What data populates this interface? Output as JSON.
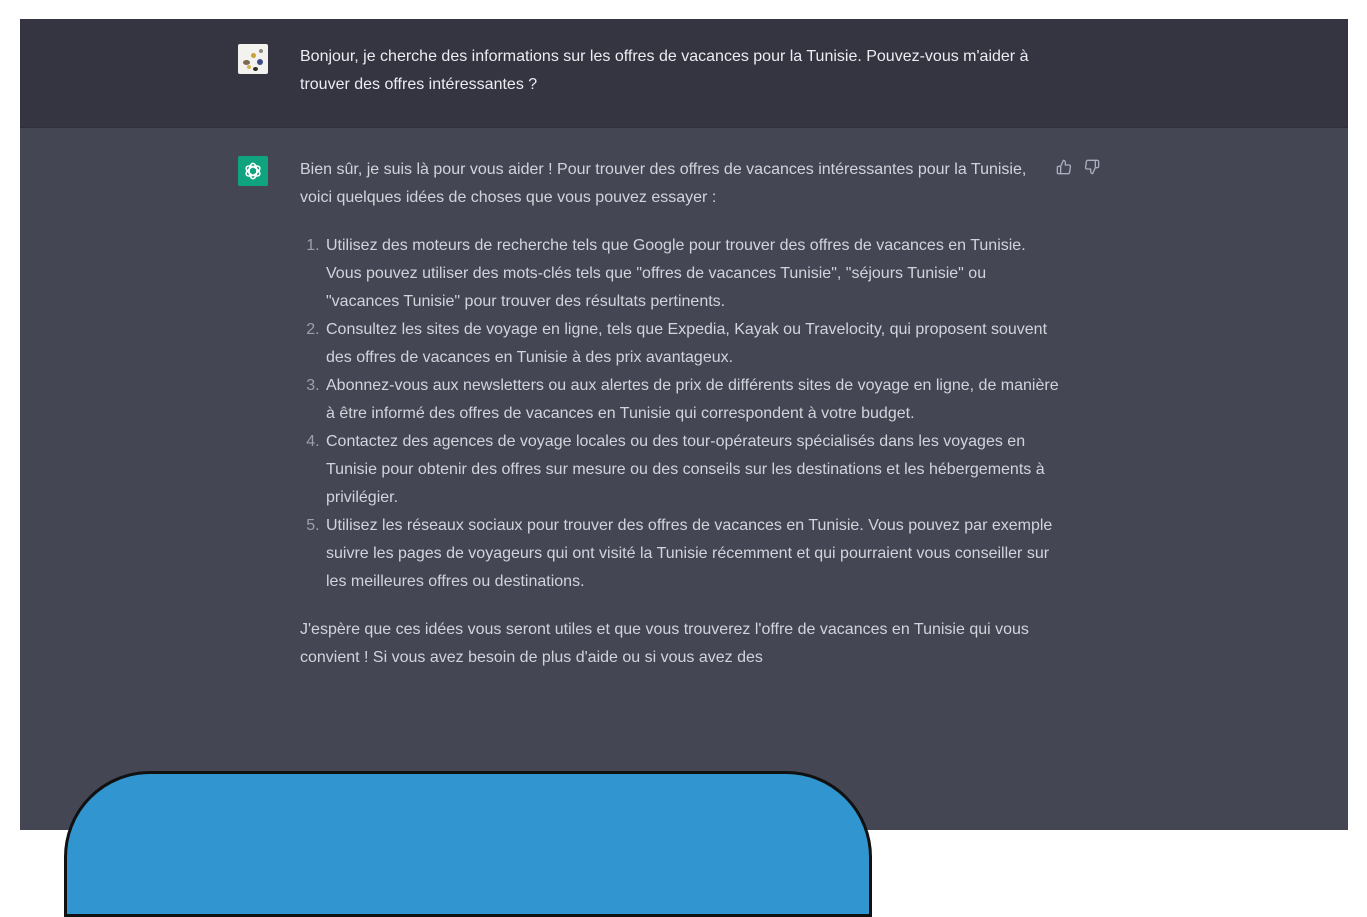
{
  "conversation": {
    "user_message": {
      "text": "Bonjour, je cherche des informations sur les offres de vacances pour la Tunisie. Pouvez-vous m'aider à trouver des offres intéressantes ?"
    },
    "assistant_message": {
      "intro": "Bien sûr, je suis là pour vous aider ! Pour trouver des offres de vacances intéressantes pour la Tunisie, voici quelques idées de choses que vous pouvez essayer :",
      "list": [
        "Utilisez des moteurs de recherche tels que Google pour trouver des offres de vacances en Tunisie. Vous pouvez utiliser des mots-clés tels que \"offres de vacances Tunisie\", \"séjours Tunisie\" ou \"vacances Tunisie\" pour trouver des résultats pertinents.",
        "Consultez les sites de voyage en ligne, tels que Expedia, Kayak ou Travelocity, qui proposent souvent des offres de vacances en Tunisie à des prix avantageux.",
        "Abonnez-vous aux newsletters ou aux alertes de prix de différents sites de voyage en ligne, de manière à être informé des offres de vacances en Tunisie qui correspondent à votre budget.",
        "Contactez des agences de voyage locales ou des tour-opérateurs spécialisés dans les voyages en Tunisie pour obtenir des offres sur mesure ou des conseils sur les destinations et les hébergements à privilégier.",
        "Utilisez les réseaux sociaux pour trouver des offres de vacances en Tunisie. Vous pouvez par exemple suivre les pages de voyageurs qui ont visité la Tunisie récemment et qui pourraient vous conseiller sur les meilleures offres ou destinations."
      ],
      "closing": "J'espère que ces idées vous seront utiles et que vous trouverez l'offre de vacances en Tunisie qui vous convient ! Si vous avez besoin de plus d'aide ou si vous avez des"
    }
  },
  "icons": {
    "user_avatar": "user-avatar-image",
    "bot_avatar": "openai-logo-icon",
    "thumbs_up": "thumbs-up-icon",
    "thumbs_down": "thumbs-down-icon"
  },
  "colors": {
    "user_bg": "#343541",
    "assistant_bg": "#444654",
    "bot_avatar_bg": "#10a37f",
    "overlay_blob": "#3196cf"
  }
}
